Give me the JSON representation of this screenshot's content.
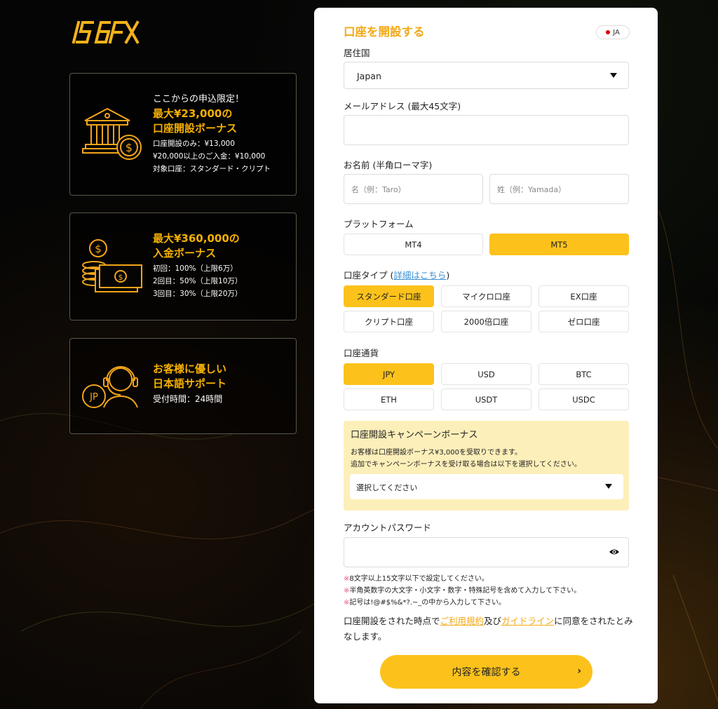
{
  "brand": {
    "logo_text": "IS6FX"
  },
  "promos": [
    {
      "subtitle": "ここからの申込限定！",
      "headline1": "最大¥23,000の",
      "headline2": "口座開設ボーナス",
      "lines": [
        "口座開設のみ：¥13,000",
        "¥20,000以上のご入金：¥10,000",
        "対象口座：スタンダード・クリプト"
      ]
    },
    {
      "headline1": "最大¥360,000の",
      "headline2": "入金ボーナス",
      "lines": [
        "初回：100%（上限6万）",
        "2回目：50%（上限10万）",
        "3回目：30%（上限20万）"
      ]
    },
    {
      "headline1": "お客様に優しい",
      "headline2": "日本語サポート",
      "lines": [
        "受付時間：24時間"
      ],
      "badge": "JP"
    }
  ],
  "form": {
    "title": "口座を開設する",
    "language": "JA",
    "country": {
      "label": "居住国",
      "value": "Japan"
    },
    "email": {
      "label": "メールアドレス (最大45文字)",
      "value": ""
    },
    "name": {
      "label": "お名前 (半角ローマ字)",
      "first_placeholder": "名（例：Taro）",
      "last_placeholder": "姓（例：Yamada）"
    },
    "platform": {
      "label": "プラットフォーム",
      "options": [
        "MT4",
        "MT5"
      ],
      "selected": "MT5"
    },
    "account_type": {
      "label": "口座タイプ (",
      "link": "詳細はこちら",
      "label_end": ")",
      "options": [
        "スタンダード口座",
        "マイクロ口座",
        "EX口座",
        "クリプト口座",
        "2000倍口座",
        "ゼロ口座"
      ],
      "selected": "スタンダード口座"
    },
    "currency": {
      "label": "口座通貨",
      "options": [
        "JPY",
        "USD",
        "BTC",
        "ETH",
        "USDT",
        "USDC"
      ],
      "selected": "JPY"
    },
    "bonus": {
      "title": "口座開設キャンペーンボーナス",
      "note1": "お客様は口座開設ボーナス¥3,000を受取りできます。",
      "note2": "追加でキャンペーンボーナスを受け取る場合は以下を選択してください。",
      "select_value": "選択してください"
    },
    "password": {
      "label": "アカウントパスワード",
      "value": "",
      "rules": [
        "8文字以上15文字以下で設定してください。",
        "半角英数字の大文字・小文字・数字・特殊記号を含めて入力して下さい。",
        "記号は!@#$%&*?.~_の中から入力して下さい。"
      ],
      "mark": "※"
    },
    "agreement": {
      "prefix": "口座開設をされた時点で",
      "terms": "ご利用規約",
      "mid": "及び",
      "guide": "ガイドライン",
      "suffix": "に同意をされたとみなします。"
    },
    "submit_label": "内容を確認する",
    "submit_chevron": "›"
  },
  "colors": {
    "accent": "#fcc21b",
    "orange_text": "#f3a916",
    "bonus_bg": "#fdefb9",
    "page_bg": "#050505"
  }
}
